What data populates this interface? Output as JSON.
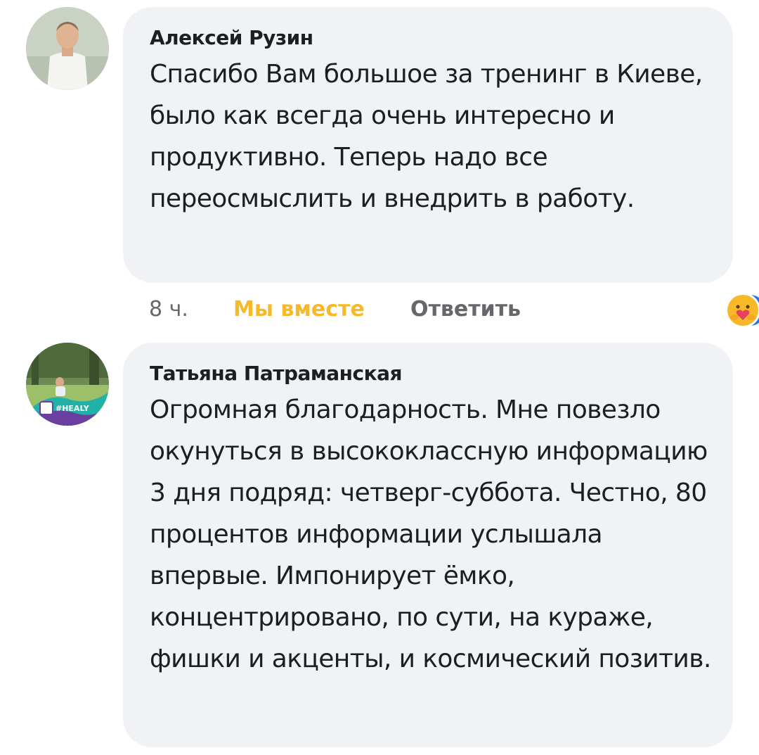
{
  "comments": [
    {
      "author": "Алексей Рузин",
      "text": "Спасибо Вам большое за тренинг в Киеве, было как всегда очень интересно и продуктивно. Теперь надо все переосмыслить и внедрить в работу.",
      "time": "8 ч.",
      "like_label": "Мы вместе",
      "reply_label": "Ответить",
      "reaction_count": "2",
      "reactions": [
        "like-icon",
        "care-icon"
      ]
    },
    {
      "author": "Татьяна Патраманская",
      "text": "Огромная благодарность. Мне повезло окунуться в высококлассную информацию 3 дня подряд: четверг-суббота.  Честно, 80 процентов информации услышала  впервые. Импонирует ёмко, концентрировано, по сути, на кураже, фишки и акценты, и космический позитив.",
      "avatar_badge": "#HEALY"
    }
  ],
  "colors": {
    "bubble": "#f0f2f5",
    "like_active": "#f7b928",
    "meta": "#65676b",
    "like_blue": "#1877f2"
  }
}
